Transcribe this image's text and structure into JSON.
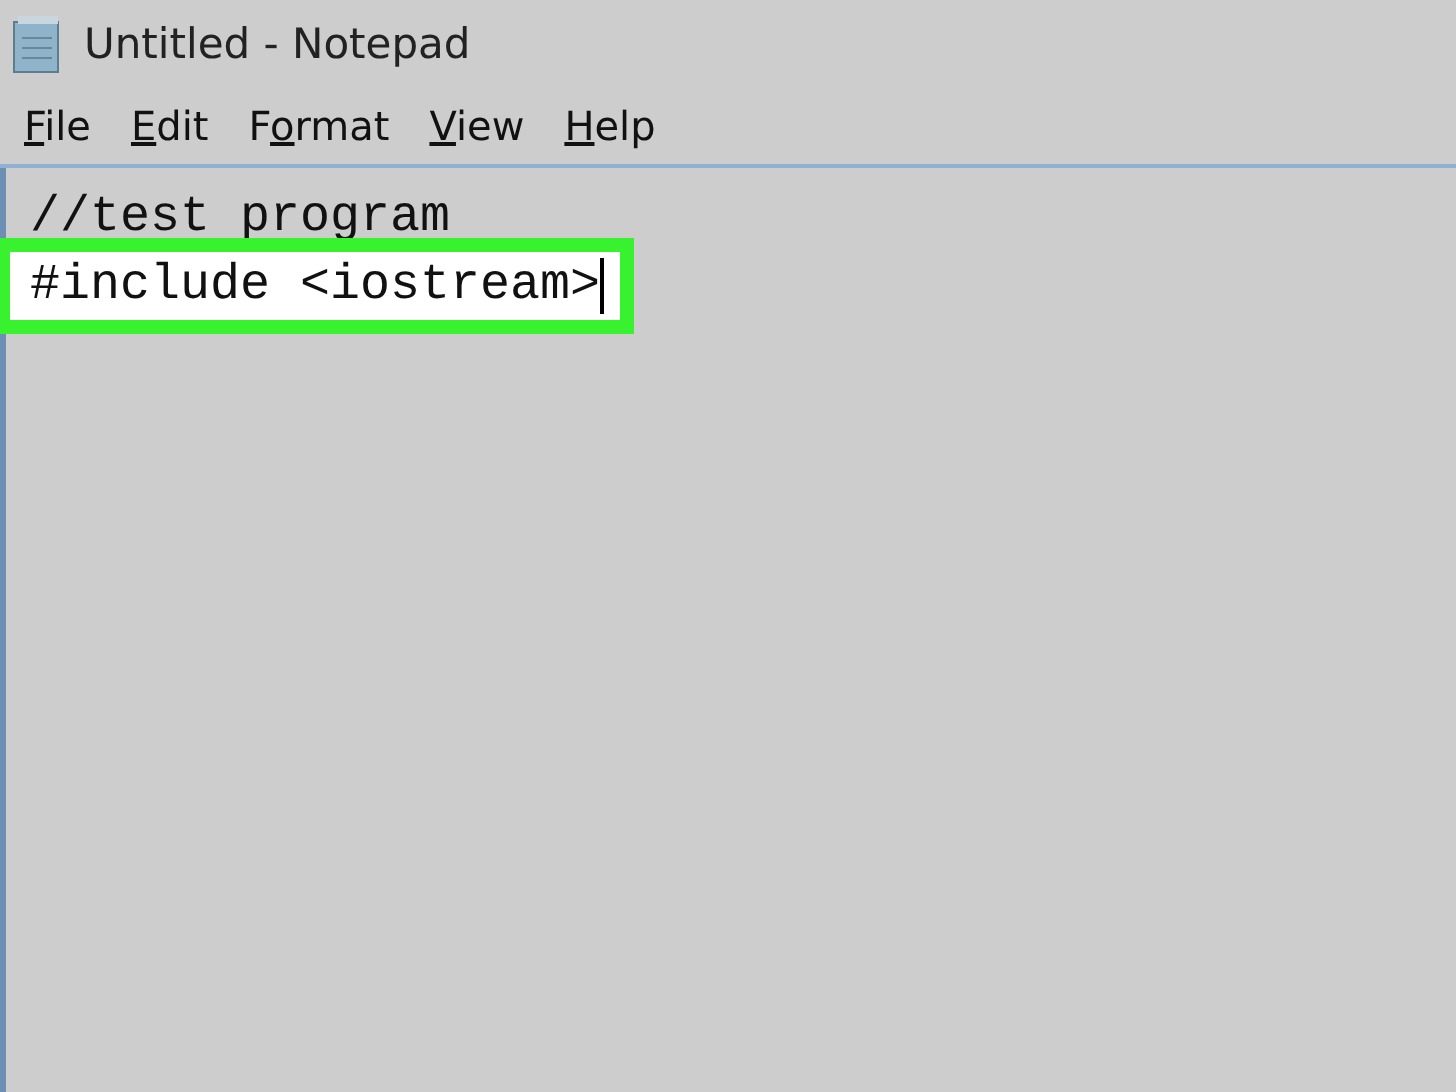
{
  "window": {
    "title": "Untitled - Notepad"
  },
  "menu": [
    {
      "segments": [
        {
          "text": "F",
          "underlined": true
        },
        {
          "text": "ile",
          "underlined": false
        }
      ]
    },
    {
      "segments": [
        {
          "text": "E",
          "underlined": true
        },
        {
          "text": "dit",
          "underlined": false
        }
      ]
    },
    {
      "segments": [
        {
          "text": "F",
          "underlined": false
        },
        {
          "text": "o",
          "underlined": true
        },
        {
          "text": "rmat",
          "underlined": false
        }
      ]
    },
    {
      "segments": [
        {
          "text": "V",
          "underlined": true
        },
        {
          "text": "iew",
          "underlined": false
        }
      ]
    },
    {
      "segments": [
        {
          "text": "H",
          "underlined": true
        },
        {
          "text": "elp",
          "underlined": false
        }
      ]
    }
  ],
  "editor": {
    "lines": [
      {
        "text": "//test program",
        "highlighted": false,
        "caret": false
      },
      {
        "text": "#include <iostream>",
        "highlighted": true,
        "caret": true
      }
    ]
  }
}
